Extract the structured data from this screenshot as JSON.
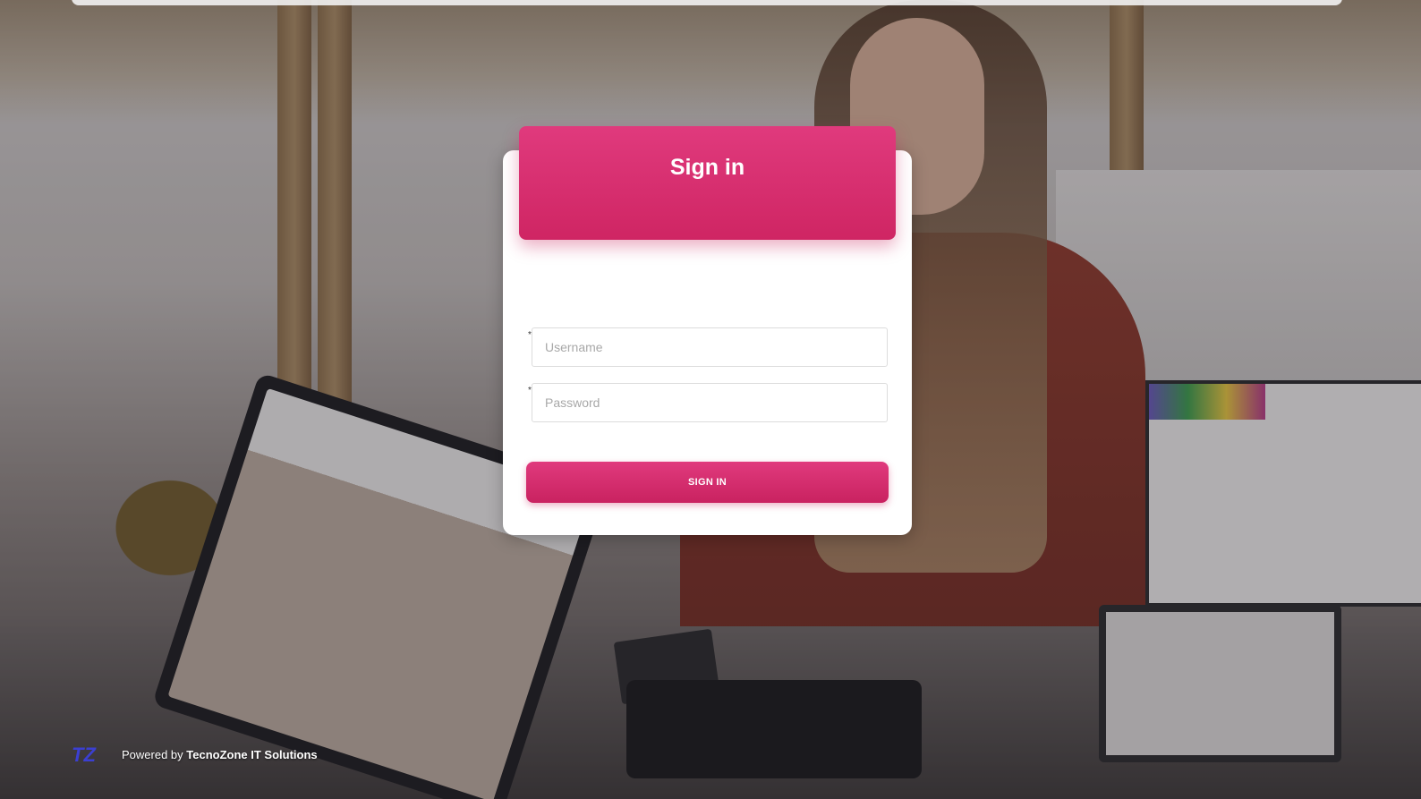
{
  "login": {
    "title": "Sign in",
    "username_placeholder": "Username",
    "password_placeholder": "Password",
    "required_marker": "*",
    "submit_label": "SIGN IN"
  },
  "footer": {
    "logo_text": "TZ",
    "powered_prefix": "Powered by ",
    "company_name": "TecnoZone IT Solutions"
  },
  "colors": {
    "accent": "#d62d6c",
    "accent_dark": "#c92260",
    "logo_blue": "#3b3fd1"
  },
  "icons": {
    "logo": "tz-logo-icon"
  }
}
